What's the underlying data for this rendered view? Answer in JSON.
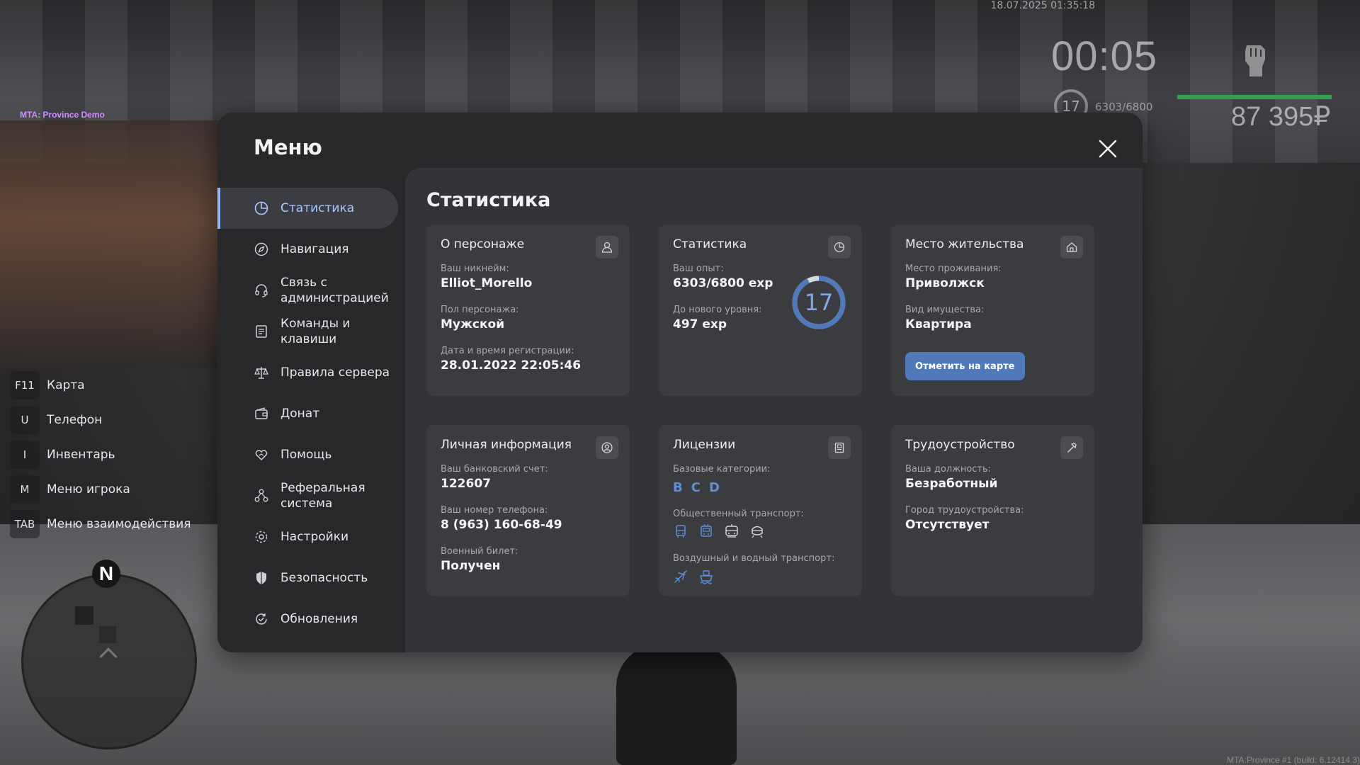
{
  "hud": {
    "datetime": "18.07.2025 01:35:18",
    "timer": "00:05",
    "level": "17",
    "exp": "6303/6800",
    "money": "87 395₽",
    "server_name": "MTA: Province Demo",
    "build": "MTA:Province #1 (build: 6.12414.3)",
    "health_fraction": 1.0
  },
  "keybinds": [
    {
      "key": "F11",
      "label": "Карта"
    },
    {
      "key": "U",
      "label": "Телефон"
    },
    {
      "key": "I",
      "label": "Инвентарь"
    },
    {
      "key": "M",
      "label": "Меню игрока"
    },
    {
      "key": "TAB",
      "label": "Меню взаимодействия"
    }
  ],
  "minimap": {
    "north": "N"
  },
  "menu": {
    "title": "Меню",
    "nav": [
      {
        "label": "Статистика",
        "icon": "pie-chart-icon",
        "active": true
      },
      {
        "label": "Навигация",
        "icon": "compass-icon"
      },
      {
        "label": "Связь с администрацией",
        "icon": "headset-icon"
      },
      {
        "label": "Команды и клавиши",
        "icon": "document-icon"
      },
      {
        "label": "Правила сервера",
        "icon": "scales-icon"
      },
      {
        "label": "Донат",
        "icon": "wallet-icon"
      },
      {
        "label": "Помощь",
        "icon": "heart-hand-icon"
      },
      {
        "label": "Реферальная система",
        "icon": "referral-icon"
      },
      {
        "label": "Настройки",
        "icon": "gear-icon"
      },
      {
        "label": "Безопасность",
        "icon": "shield-icon"
      },
      {
        "label": "Обновления",
        "icon": "refresh-check-icon"
      }
    ]
  },
  "stats": {
    "title": "Статистика",
    "character": {
      "title": "О персонаже",
      "nickname_label": "Ваш никнейм:",
      "nickname": "Elliot_Morello",
      "gender_label": "Пол персонажа:",
      "gender": "Мужской",
      "reg_label": "Дата и время регистрации:",
      "reg_date": "28.01.2022 22:05:46"
    },
    "progress": {
      "title": "Статистика",
      "exp_label": "Ваш опыт:",
      "exp": "6303/6800 exp",
      "next_label": "До нового уровня:",
      "next": "497 exp",
      "level": "17",
      "level_progress": 0.927
    },
    "residence": {
      "title": "Место жительства",
      "place_label": "Место проживания:",
      "place": "Приволжск",
      "property_label": "Вид имущества:",
      "property": "Квартира",
      "button": "Отметить на карте"
    },
    "personal": {
      "title": "Личная информация",
      "bank_label": "Ваш банковский счет:",
      "bank": "122607",
      "phone_label": "Ваш номер телефона:",
      "phone": "8 (963) 160-68-49",
      "military_label": "Военный билет:",
      "military": "Получен"
    },
    "licenses": {
      "title": "Лицензии",
      "base_label": "Базовые категории:",
      "base": [
        "B",
        "C",
        "D"
      ],
      "public_label": "Общественный транспорт:",
      "public_icons": [
        "bus-icon",
        "trolleybus-icon",
        "tram-icon",
        "metro-icon"
      ],
      "air_water_label": "Воздушный и водный транспорт:",
      "air_water_icons": [
        "plane-icon",
        "boat-icon"
      ]
    },
    "job": {
      "title": "Трудоустройство",
      "position_label": "Ваша должность:",
      "position": "Безработный",
      "city_label": "Город трудоустройства:",
      "city": "Отсутствует"
    }
  },
  "colors": {
    "accent": "#8fb8f5",
    "license_blue": "#5d8fd8",
    "button_blue": "#4f79b8",
    "health_green": "#2fa14f",
    "server_label": "#d18cff"
  }
}
